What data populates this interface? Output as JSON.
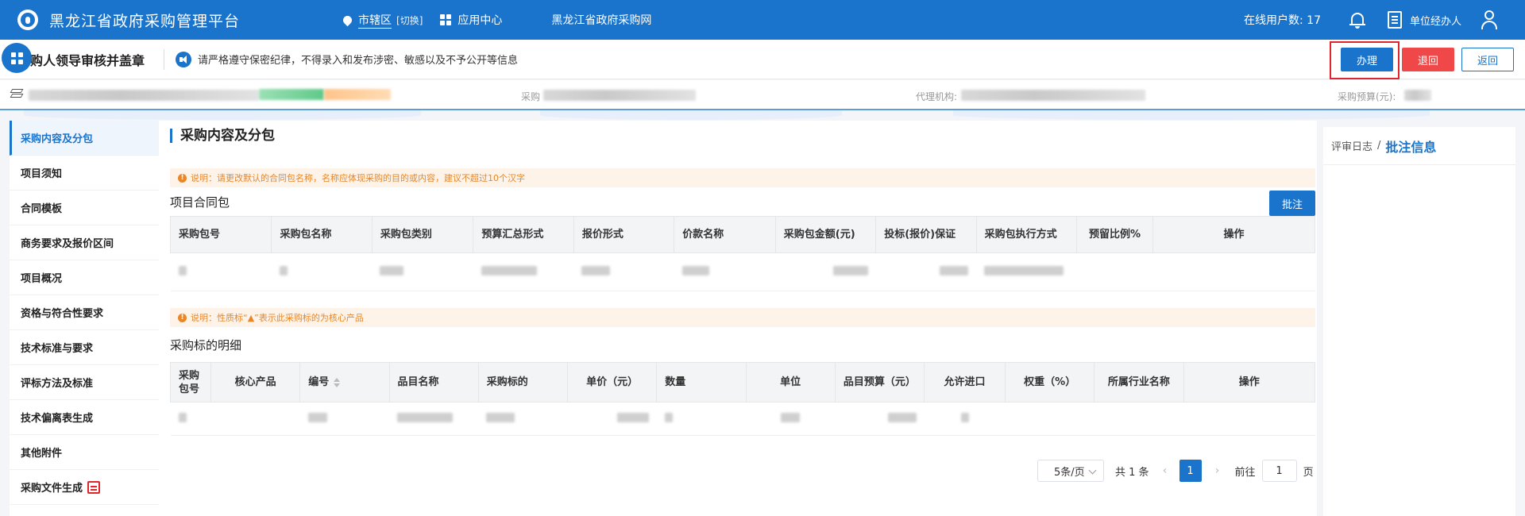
{
  "header": {
    "title": "黑龙江省政府采购管理平台",
    "region": "市辖区",
    "region_switch": "[切换]",
    "app_center": "应用中心",
    "gov_link": "黑龙江省政府采购网",
    "online_label": "在线用户数: 17",
    "unit_handler": "单位经办人"
  },
  "toolbar": {
    "page_title": "购人领导审核并盖章",
    "notice": "请严格遵守保密纪律，不得录入和发布涉密、敏感以及不予公开等信息",
    "handle": "办理",
    "reject": "退回",
    "back": "返回"
  },
  "info": {
    "field_procure": "采购",
    "field_agency": "代理机构:",
    "field_budget": "采购预算(元):"
  },
  "sidebar": {
    "items": [
      {
        "label": "采购内容及分包"
      },
      {
        "label": "项目须知"
      },
      {
        "label": "合同模板"
      },
      {
        "label": "商务要求及报价区间"
      },
      {
        "label": "项目概况"
      },
      {
        "label": "资格与符合性要求"
      },
      {
        "label": "技术标准与要求"
      },
      {
        "label": "评标方法及标准"
      },
      {
        "label": "技术偏离表生成"
      },
      {
        "label": "其他附件"
      },
      {
        "label": "采购文件生成"
      }
    ]
  },
  "main": {
    "title": "采购内容及分包",
    "tip1": "说明：请更改默认的合同包名称，名称应体现采购的目的或内容，建议不超过10个汉字",
    "contract_title": "项目合同包",
    "annotate": "批注",
    "contract_cols": [
      "采购包号",
      "采购包名称",
      "采购包类别",
      "预算汇总形式",
      "报价形式",
      "价款名称",
      "采购包金额(元)",
      "投标(报价)保证",
      "采购包执行方式",
      "预留比例%",
      "操作"
    ],
    "tip2": "说明：性质标“▲”表示此采购标的为核心产品",
    "detail_title": "采购标的明细",
    "detail_cols": [
      "采购包号",
      "核心产品",
      "编号",
      "品目名称",
      "采购标的",
      "单价（元）",
      "数量",
      "单位",
      "品目预算（元）",
      "允许进口",
      "权重（%）",
      "所属行业名称",
      "操作"
    ]
  },
  "pager": {
    "page_size": "5条/页",
    "total": "共 1 条",
    "prev": "‹",
    "current": "1",
    "next": "›",
    "goto": "前往",
    "goto_value": "1",
    "page_unit": "页"
  },
  "right": {
    "log": "评审日志",
    "sep": "/",
    "current": "批注信息"
  }
}
